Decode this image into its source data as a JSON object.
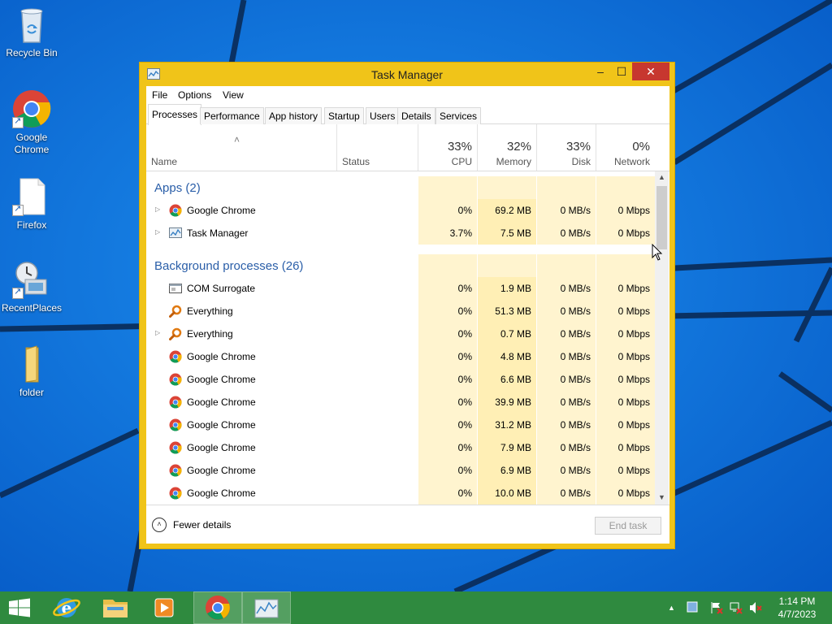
{
  "desktop": {
    "icons": [
      {
        "label_line1": "Recycle Bin",
        "label_line2": "",
        "icon": "recycle-bin-icon"
      },
      {
        "label_line1": "Google",
        "label_line2": "Chrome",
        "icon": "chrome-icon"
      },
      {
        "label_line1": "Firefox",
        "label_line2": "",
        "icon": "document-icon"
      },
      {
        "label_line1": "RecentPlaces",
        "label_line2": "",
        "icon": "recent-places-icon"
      },
      {
        "label_line1": "folder",
        "label_line2": "",
        "icon": "folder-icon"
      }
    ]
  },
  "window": {
    "title": "Task Manager",
    "controls": {
      "minimize": "–",
      "maximize": "☐",
      "close": "✕"
    },
    "menu": [
      "File",
      "Options",
      "View"
    ],
    "tabs": [
      "Processes",
      "Performance",
      "App history",
      "Startup",
      "Users",
      "Details",
      "Services"
    ],
    "active_tab": "Processes",
    "sort_arrow": "˄",
    "columns": {
      "name": "Name",
      "status": "Status",
      "cpu": {
        "pct": "33%",
        "label": "CPU"
      },
      "memory": {
        "pct": "32%",
        "label": "Memory"
      },
      "disk": {
        "pct": "33%",
        "label": "Disk"
      },
      "network": {
        "pct": "0%",
        "label": "Network"
      }
    },
    "groups": [
      {
        "title": "Apps (2)",
        "rows": [
          {
            "name": "Google Chrome",
            "icon": "chrome",
            "expandable": true,
            "cpu": "0%",
            "memory": "69.2 MB",
            "disk": "0 MB/s",
            "network": "0 Mbps"
          },
          {
            "name": "Task Manager",
            "icon": "taskmgr",
            "expandable": true,
            "cpu": "3.7%",
            "memory": "7.5 MB",
            "disk": "0 MB/s",
            "network": "0 Mbps"
          }
        ]
      },
      {
        "title": "Background processes (26)",
        "rows": [
          {
            "name": "COM Surrogate",
            "icon": "window",
            "expandable": false,
            "cpu": "0%",
            "memory": "1.9 MB",
            "disk": "0 MB/s",
            "network": "0 Mbps"
          },
          {
            "name": "Everything",
            "icon": "magnifier",
            "expandable": false,
            "cpu": "0%",
            "memory": "51.3 MB",
            "disk": "0 MB/s",
            "network": "0 Mbps"
          },
          {
            "name": "Everything",
            "icon": "magnifier",
            "expandable": true,
            "cpu": "0%",
            "memory": "0.7 MB",
            "disk": "0 MB/s",
            "network": "0 Mbps"
          },
          {
            "name": "Google Chrome",
            "icon": "chrome",
            "expandable": false,
            "cpu": "0%",
            "memory": "4.8 MB",
            "disk": "0 MB/s",
            "network": "0 Mbps"
          },
          {
            "name": "Google Chrome",
            "icon": "chrome",
            "expandable": false,
            "cpu": "0%",
            "memory": "6.6 MB",
            "disk": "0 MB/s",
            "network": "0 Mbps"
          },
          {
            "name": "Google Chrome",
            "icon": "chrome",
            "expandable": false,
            "cpu": "0%",
            "memory": "39.9 MB",
            "disk": "0 MB/s",
            "network": "0 Mbps"
          },
          {
            "name": "Google Chrome",
            "icon": "chrome",
            "expandable": false,
            "cpu": "0%",
            "memory": "31.2 MB",
            "disk": "0 MB/s",
            "network": "0 Mbps"
          },
          {
            "name": "Google Chrome",
            "icon": "chrome",
            "expandable": false,
            "cpu": "0%",
            "memory": "7.9 MB",
            "disk": "0 MB/s",
            "network": "0 Mbps"
          },
          {
            "name": "Google Chrome",
            "icon": "chrome",
            "expandable": false,
            "cpu": "0%",
            "memory": "6.9 MB",
            "disk": "0 MB/s",
            "network": "0 Mbps"
          },
          {
            "name": "Google Chrome",
            "icon": "chrome",
            "expandable": false,
            "cpu": "0%",
            "memory": "10.0 MB",
            "disk": "0 MB/s",
            "network": "0 Mbps"
          }
        ]
      }
    ],
    "footer": {
      "fewer_details": "Fewer details",
      "end_task": "End task"
    }
  },
  "taskbar": {
    "items": [
      "start-button",
      "internet-explorer",
      "file-explorer",
      "media-player",
      "chrome",
      "task-manager"
    ],
    "active_items": [
      "chrome",
      "task-manager"
    ],
    "tray": {
      "show_hidden": "▲"
    },
    "clock": {
      "time": "1:14 PM",
      "date": "4/7/2023"
    }
  },
  "colors": {
    "window_frame": "#f0c419",
    "close_button": "#c7372f",
    "group_title": "#2a5ea8",
    "heat_light": "#fff4cf",
    "heat_mid": "#ffefb5",
    "taskbar": "#2f8a3f",
    "desktop": "#0a6fd8"
  }
}
